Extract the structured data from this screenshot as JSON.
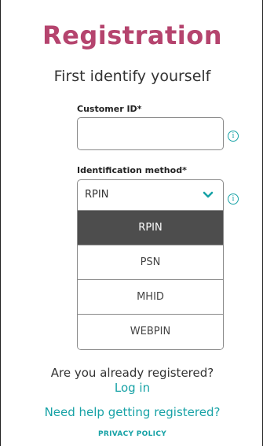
{
  "page": {
    "title": "Registration",
    "subtitle": "First identify yourself"
  },
  "form": {
    "customer_id": {
      "label": "Customer ID*",
      "value": "",
      "info_icon": "info-icon"
    },
    "identification_method": {
      "label": "Identification method*",
      "selected": "RPIN",
      "options": [
        "RPIN",
        "PSN",
        "MHID",
        "WEBPIN"
      ],
      "highlighted_option": "RPIN",
      "info_icon": "info-icon",
      "chevron_icon": "chevron-down-icon"
    }
  },
  "footer": {
    "already_registered": "Are you already registered?",
    "login_link": "Log in",
    "help_link": "Need help getting registered?",
    "privacy_link": "PRIVACY POLICY"
  },
  "colors": {
    "title": "#b5446e",
    "accent": "#17a2a6",
    "selected_option_bg": "#4d4d4d"
  }
}
